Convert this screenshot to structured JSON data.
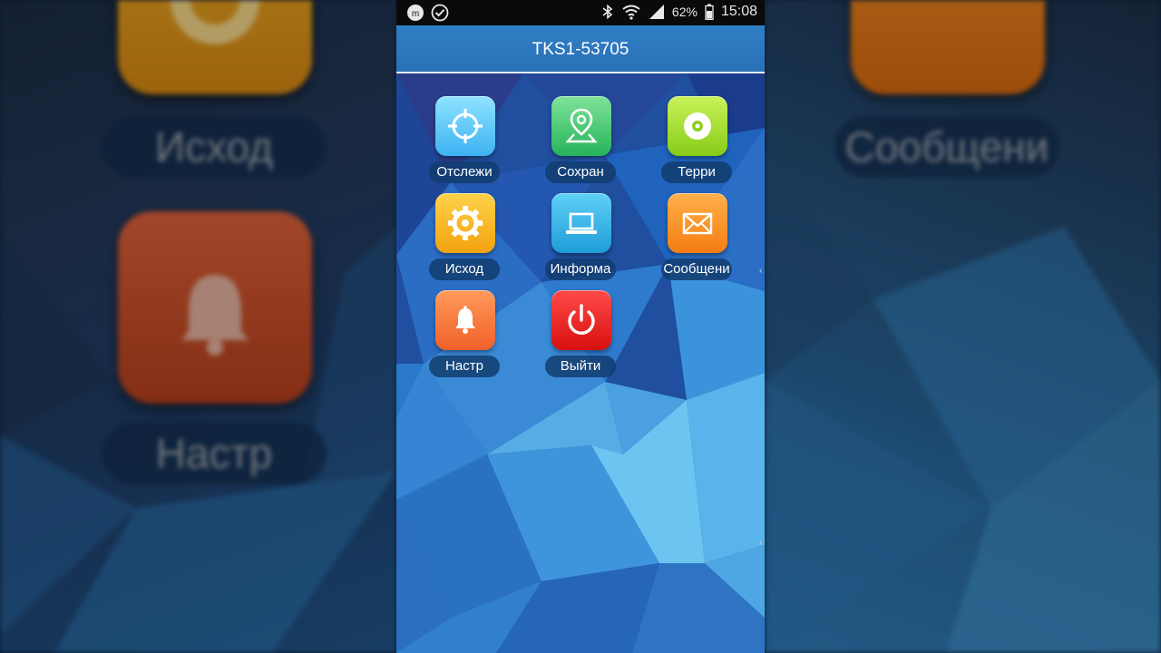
{
  "status_bar": {
    "battery_percent": "62%",
    "time": "15:08",
    "icons": [
      "app-notification-icon",
      "check-circle-icon",
      "bluetooth-icon",
      "wifi-icon",
      "signal-icon",
      "battery-icon"
    ]
  },
  "header": {
    "title": "TKS1-53705"
  },
  "apps": [
    {
      "label": "Отслежи",
      "icon": "crosshair-icon",
      "color_top": "#8fe3ff",
      "color_bottom": "#3db2f2"
    },
    {
      "label": "Сохран",
      "icon": "map-pin-icon",
      "color_top": "#7fe39a",
      "color_bottom": "#26b45a"
    },
    {
      "label": "Терри",
      "icon": "disc-icon",
      "color_top": "#c9f25a",
      "color_bottom": "#86cc17"
    },
    {
      "label": "Исход",
      "icon": "gear-icon",
      "color_top": "#ffd24a",
      "color_bottom": "#f2a20f"
    },
    {
      "label": "Информа",
      "icon": "laptop-icon",
      "color_top": "#5fd1f7",
      "color_bottom": "#1f9cd9"
    },
    {
      "label": "Сообщени",
      "icon": "envelope-icon",
      "color_top": "#ffb04a",
      "color_bottom": "#f57d12"
    },
    {
      "label": "Настр",
      "icon": "bell-icon",
      "color_top": "#ff9a5a",
      "color_bottom": "#f0602a"
    },
    {
      "label": "Выйти",
      "icon": "power-icon",
      "color_top": "#ff4a4a",
      "color_bottom": "#d80f0f"
    }
  ],
  "backdrop": {
    "left_labels": [
      "Исход",
      "Настр"
    ],
    "right_labels": [
      "Сообщени"
    ]
  }
}
